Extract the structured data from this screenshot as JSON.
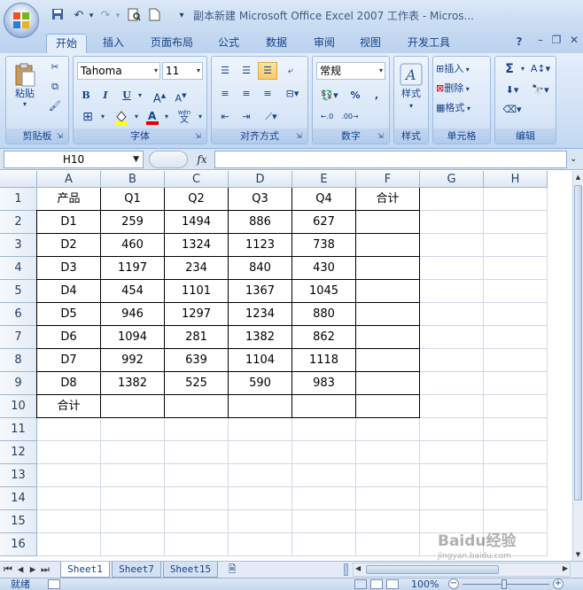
{
  "window": {
    "title": "副本新建 Microsoft Office Excel 2007 工作表 - Micros..."
  },
  "tabs": [
    "开始",
    "插入",
    "页面布局",
    "公式",
    "数据",
    "审阅",
    "视图",
    "开发工具"
  ],
  "ribbon": {
    "clipboard": {
      "label": "剪贴板",
      "paste": "粘贴"
    },
    "font": {
      "label": "字体",
      "name": "Tahoma",
      "size": "11",
      "bold": "B",
      "italic": "I",
      "underline": "U",
      "phonetic": "wén"
    },
    "alignment": {
      "label": "对齐方式"
    },
    "number": {
      "label": "数字",
      "format": "常规",
      "percent": "%",
      "comma": ","
    },
    "styles": {
      "label": "样式"
    },
    "cells": {
      "label": "单元格",
      "insert": "插入",
      "delete": "删除",
      "format": "格式"
    },
    "editing": {
      "label": "编辑",
      "sum": "Σ"
    }
  },
  "formula_bar": {
    "name_box": "H10",
    "fx": "fx",
    "value": ""
  },
  "columns": [
    "A",
    "B",
    "C",
    "D",
    "E",
    "F",
    "G",
    "H"
  ],
  "rows": [
    "1",
    "2",
    "3",
    "4",
    "5",
    "6",
    "7",
    "8",
    "9",
    "10",
    "11",
    "12",
    "13",
    "14",
    "15",
    "16"
  ],
  "table": {
    "header": [
      "产品",
      "Q1",
      "Q2",
      "Q3",
      "Q4",
      "合计"
    ],
    "data": [
      [
        "D1",
        "259",
        "1494",
        "886",
        "627",
        ""
      ],
      [
        "D2",
        "460",
        "1324",
        "1123",
        "738",
        ""
      ],
      [
        "D3",
        "1197",
        "234",
        "840",
        "430",
        ""
      ],
      [
        "D4",
        "454",
        "1101",
        "1367",
        "1045",
        ""
      ],
      [
        "D5",
        "946",
        "1297",
        "1234",
        "880",
        ""
      ],
      [
        "D6",
        "1094",
        "281",
        "1382",
        "862",
        ""
      ],
      [
        "D7",
        "992",
        "639",
        "1104",
        "1118",
        ""
      ],
      [
        "D8",
        "1382",
        "525",
        "590",
        "983",
        ""
      ]
    ],
    "total_row": [
      "合计",
      "",
      "",
      "",
      "",
      ""
    ]
  },
  "sheets": [
    "Sheet1",
    "Sheet7",
    "Sheet15"
  ],
  "status": {
    "ready": "就绪",
    "zoom": "100%"
  },
  "watermark": {
    "text": "Baidu经验",
    "sub": "jingyan.baidu.com"
  },
  "colors": {
    "accent": "#15428b",
    "tab_active": "#e4eefb",
    "highlight": "#fbc866"
  }
}
